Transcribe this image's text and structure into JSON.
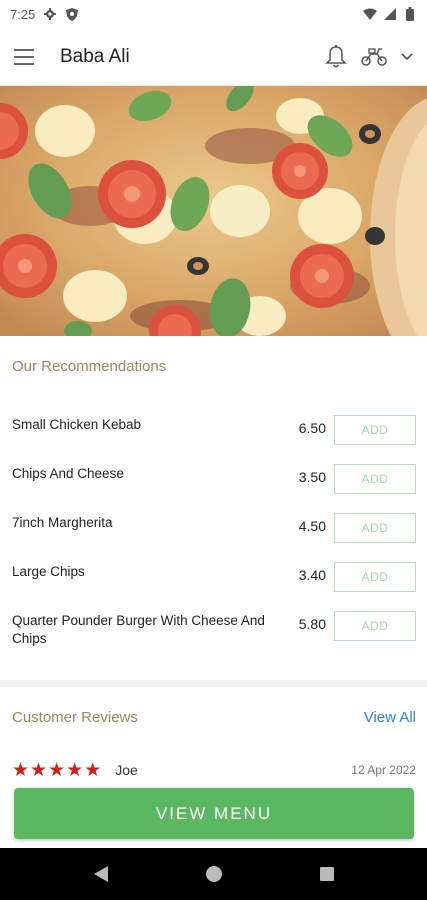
{
  "status_bar": {
    "time": "7:25",
    "icons": [
      "settings-gear-icon",
      "shield-icon",
      "wifi-icon",
      "signal-icon",
      "battery-icon"
    ]
  },
  "app_bar": {
    "title": "Baba Ali",
    "icons": [
      "menu-icon",
      "bell-icon",
      "scooter-delivery-icon",
      "chevron-down-icon"
    ]
  },
  "hero": {
    "image": "pizza-photo"
  },
  "recommendations": {
    "title": "Our Recommendations",
    "add_label": "ADD",
    "items": [
      {
        "name": "Small Chicken Kebab",
        "price": "6.50"
      },
      {
        "name": "Chips And Cheese",
        "price": "3.50"
      },
      {
        "name": "7inch Margherita",
        "price": "4.50"
      },
      {
        "name": "Large Chips",
        "price": "3.40"
      },
      {
        "name": "Quarter Pounder Burger With Cheese And Chips",
        "price": "5.80"
      }
    ]
  },
  "reviews": {
    "title": "Customer Reviews",
    "view_all": "View All",
    "items": [
      {
        "rating": 5,
        "name": "Joe",
        "date": "12 Apr 2022"
      }
    ]
  },
  "view_menu_label": "VIEW MENU",
  "nav_bar": {
    "icons": [
      "back-icon",
      "home-icon",
      "recents-icon"
    ]
  },
  "colors": {
    "accent_green": "#5cb860",
    "section_title": "#a0865a",
    "link_blue": "#2e86c1",
    "star_red": "#d0201b"
  }
}
